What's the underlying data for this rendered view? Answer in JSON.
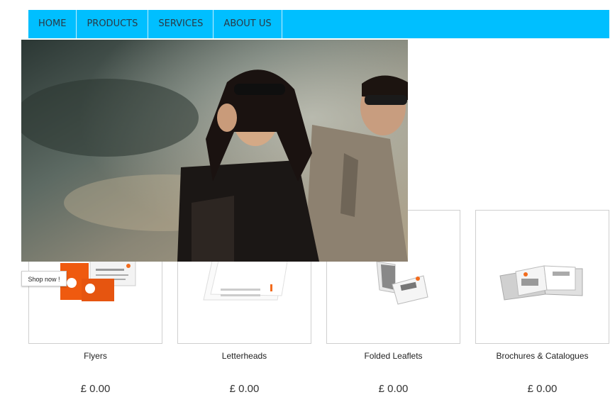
{
  "nav": {
    "items": [
      {
        "label": "HOME"
      },
      {
        "label": "PRODUCTS"
      },
      {
        "label": "SERVICES"
      },
      {
        "label": "ABOUT US"
      }
    ],
    "color": "#00bfff"
  },
  "hero": {
    "button_label": "Shop now !"
  },
  "products": [
    {
      "name": "Flyers",
      "price": "£ 0.00",
      "icon": "flyers-image"
    },
    {
      "name": "Letterheads",
      "price": "£ 0.00",
      "icon": "letterheads-image"
    },
    {
      "name": "Folded Leaflets",
      "price": "£ 0.00",
      "icon": "folded-leaflets-image"
    },
    {
      "name": "Brochures & Catalogues",
      "price": "£ 0.00",
      "icon": "brochures-image"
    }
  ]
}
